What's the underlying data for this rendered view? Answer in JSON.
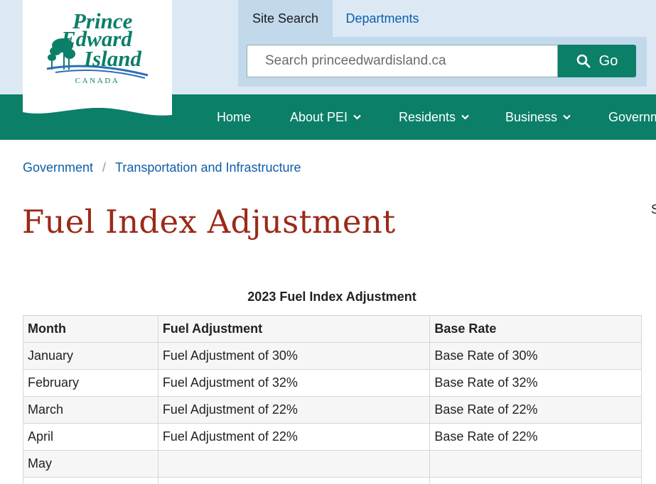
{
  "logo": {
    "line1": "Prince",
    "line2": "Edward",
    "line3": "Island",
    "country": "CANADA"
  },
  "search": {
    "tabs": [
      {
        "label": "Site Search",
        "active": true
      },
      {
        "label": "Departments",
        "active": false
      }
    ],
    "placeholder": "Search princeedwardisland.ca",
    "button_label": "Go",
    "button_icon": "search-icon"
  },
  "nav": {
    "items": [
      {
        "label": "Home",
        "has_dropdown": false
      },
      {
        "label": "About PEI",
        "has_dropdown": true
      },
      {
        "label": "Residents",
        "has_dropdown": true
      },
      {
        "label": "Business",
        "has_dropdown": true
      },
      {
        "label": "Governm",
        "has_dropdown": false
      }
    ]
  },
  "breadcrumb": {
    "items": [
      "Government",
      "Transportation and Infrastructure"
    ],
    "separator": "/"
  },
  "page": {
    "title": "Fuel Index Adjustment",
    "edge_text": "S"
  },
  "table": {
    "caption": "2023 Fuel Index Adjustment",
    "headers": [
      "Month",
      "Fuel Adjustment",
      "Base Rate"
    ],
    "rows": [
      [
        "January",
        "Fuel Adjustment of 30%",
        "Base Rate of 30%"
      ],
      [
        "February",
        "Fuel Adjustment of 32%",
        "Base Rate of 32%"
      ],
      [
        "March",
        "Fuel Adjustment of 22%",
        "Base Rate of 22%"
      ],
      [
        "April",
        "Fuel Adjustment of 22%",
        "Base Rate of 22%"
      ],
      [
        "May",
        "",
        ""
      ],
      [
        "",
        "",
        ""
      ]
    ]
  },
  "colors": {
    "brand_green": "#0c7f68",
    "header_blue": "#dce9f5",
    "search_panel_blue": "#c2d8eb",
    "link_blue": "#0e5ea8",
    "title_red": "#9b2a18"
  }
}
